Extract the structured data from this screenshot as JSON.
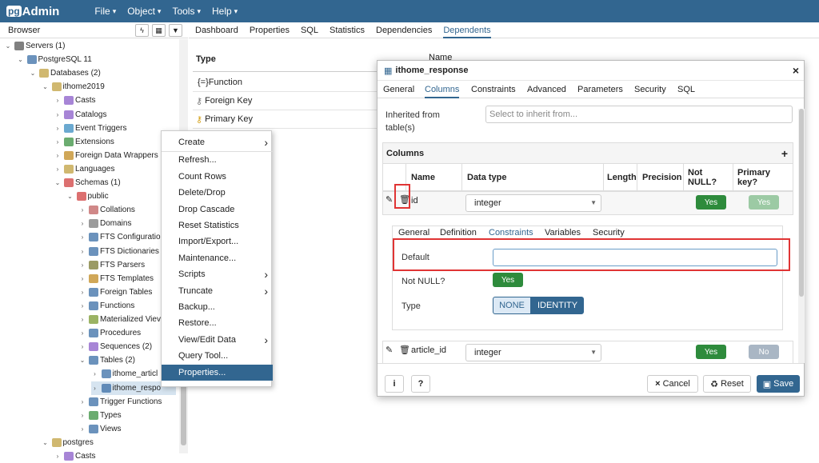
{
  "topbar": {
    "logo_pg": "pg",
    "logo_text": "Admin",
    "menus": [
      "File",
      "Object",
      "Tools",
      "Help"
    ]
  },
  "browser": {
    "title": "Browser",
    "tree": [
      {
        "label": "Servers (1)",
        "level": 0,
        "toggle": "⌄"
      },
      {
        "label": "PostgreSQL 11",
        "level": 1,
        "toggle": "⌄"
      },
      {
        "label": "Databases (2)",
        "level": 2,
        "toggle": "⌄"
      },
      {
        "label": "ithome2019",
        "level": 3,
        "toggle": "⌄"
      },
      {
        "label": "Casts",
        "level": 4,
        "toggle": "›"
      },
      {
        "label": "Catalogs",
        "level": 4,
        "toggle": "›"
      },
      {
        "label": "Event Triggers",
        "level": 4,
        "toggle": "›"
      },
      {
        "label": "Extensions",
        "level": 4,
        "toggle": "›"
      },
      {
        "label": "Foreign Data Wrappers",
        "level": 4,
        "toggle": "›"
      },
      {
        "label": "Languages",
        "level": 4,
        "toggle": "›"
      },
      {
        "label": "Schemas (1)",
        "level": 4,
        "toggle": "⌄"
      },
      {
        "label": "public",
        "level": 5,
        "toggle": "⌄"
      },
      {
        "label": "Collations",
        "level": 6,
        "toggle": "›"
      },
      {
        "label": "Domains",
        "level": 6,
        "toggle": "›"
      },
      {
        "label": "FTS Configuratio",
        "level": 6,
        "toggle": "›"
      },
      {
        "label": "FTS Dictionaries",
        "level": 6,
        "toggle": "›"
      },
      {
        "label": "FTS Parsers",
        "level": 6,
        "toggle": "›"
      },
      {
        "label": "FTS Templates",
        "level": 6,
        "toggle": "›"
      },
      {
        "label": "Foreign Tables",
        "level": 6,
        "toggle": "›"
      },
      {
        "label": "Functions",
        "level": 6,
        "toggle": "›"
      },
      {
        "label": "Materialized Viev",
        "level": 6,
        "toggle": "›"
      },
      {
        "label": "Procedures",
        "level": 6,
        "toggle": "›"
      },
      {
        "label": "Sequences (2)",
        "level": 6,
        "toggle": "›"
      },
      {
        "label": "Tables (2)",
        "level": 6,
        "toggle": "⌄"
      },
      {
        "label": "ithome_articl",
        "level": 7,
        "toggle": "›"
      },
      {
        "label": "ithome_respo",
        "level": 7,
        "toggle": "›",
        "selected": true
      },
      {
        "label": "Trigger Functions",
        "level": 6,
        "toggle": "›"
      },
      {
        "label": "Types",
        "level": 6,
        "toggle": "›"
      },
      {
        "label": "Views",
        "level": 6,
        "toggle": "›"
      },
      {
        "label": "postgres",
        "level": 3,
        "toggle": "⌄"
      },
      {
        "label": "Casts",
        "level": 4,
        "toggle": "›"
      }
    ]
  },
  "main_tabs": [
    {
      "label": "Dashboard"
    },
    {
      "label": "Properties"
    },
    {
      "label": "SQL"
    },
    {
      "label": "Statistics"
    },
    {
      "label": "Dependencies"
    },
    {
      "label": "Dependents",
      "active": true
    }
  ],
  "dependents": {
    "col_type": "Type",
    "col_name": "Name",
    "rows": [
      "{=}Function",
      "Foreign Key",
      "Primary Key"
    ]
  },
  "context_menu": {
    "items": [
      {
        "label": "Create",
        "arrow": true
      },
      {
        "label": "Refresh..."
      },
      {
        "label": "Count Rows"
      },
      {
        "label": "Delete/Drop"
      },
      {
        "label": "Drop Cascade"
      },
      {
        "label": "Reset Statistics"
      },
      {
        "label": "Import/Export..."
      },
      {
        "label": "Maintenance..."
      },
      {
        "label": "Scripts",
        "arrow": true
      },
      {
        "label": "Truncate",
        "arrow": true
      },
      {
        "label": "Backup..."
      },
      {
        "label": "Restore..."
      },
      {
        "label": "View/Edit Data",
        "arrow": true
      },
      {
        "label": "Query Tool..."
      },
      {
        "label": "Properties...",
        "highlight": true
      }
    ]
  },
  "dialog": {
    "title": "ithome_response",
    "tabs": [
      "General",
      "Columns",
      "Constraints",
      "Advanced",
      "Parameters",
      "Security",
      "SQL"
    ],
    "active_tab": "Columns",
    "inherit_label": "Inherited from table(s)",
    "inherit_placeholder": "Select to inherit from...",
    "columns_header": "Columns",
    "grid_headers": [
      "Name",
      "Data type",
      "Length",
      "Precision",
      "Not NULL?",
      "Primary key?"
    ],
    "row1": {
      "name": "id",
      "type": "integer",
      "notnull": "Yes",
      "pk": "Yes"
    },
    "subtabs": [
      "General",
      "Definition",
      "Constraints",
      "Variables",
      "Security"
    ],
    "active_subtab": "Constraints",
    "default_label": "Default",
    "notnull_label": "Not NULL?",
    "notnull_value": "Yes",
    "type_label": "Type",
    "type_options": [
      "NONE",
      "IDENTITY"
    ],
    "row2": {
      "name": "article_id",
      "type": "integer",
      "notnull": "Yes",
      "pk": "No"
    },
    "footer": {
      "info": "i",
      "help": "?",
      "cancel": "Cancel",
      "reset": "Reset",
      "save": "Save"
    }
  },
  "colors": {
    "brand": "#326690",
    "toggle_on": "#2e8b3c",
    "highlight": "#e03434"
  }
}
